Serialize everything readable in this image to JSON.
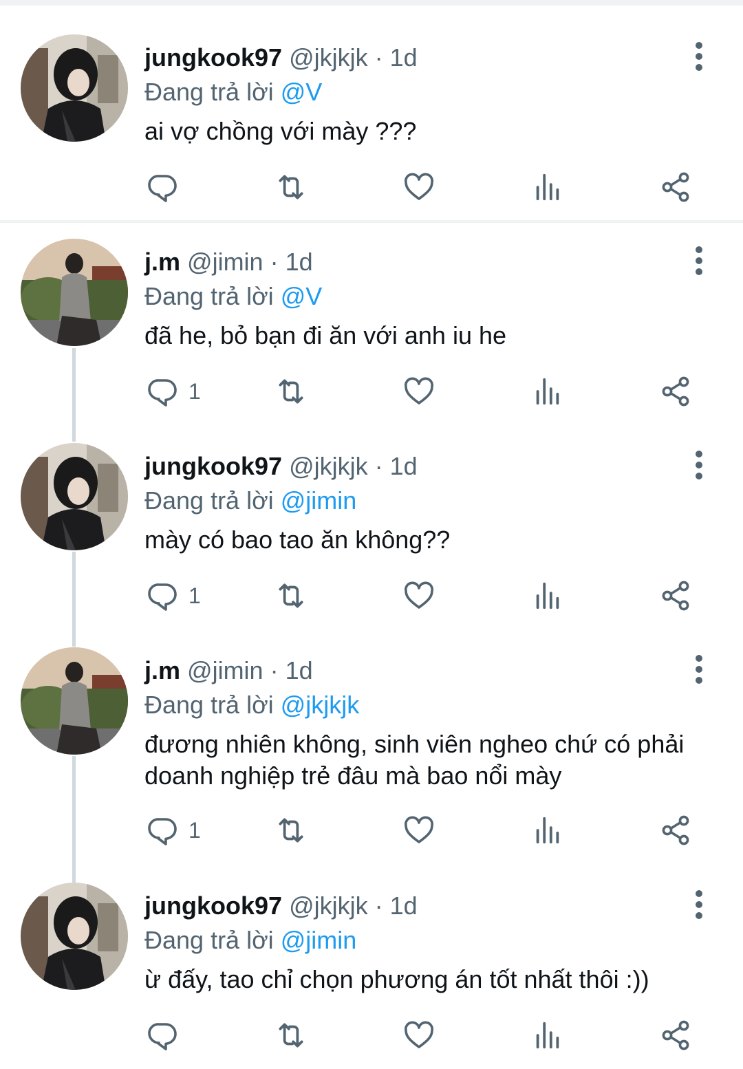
{
  "colors": {
    "accent": "#1d9bf0",
    "text_primary": "#0f1419",
    "text_secondary": "#536471",
    "divider": "#eff3f4",
    "thread_line": "#cfd9de"
  },
  "icons": {
    "reply": "reply-icon",
    "retweet": "retweet-icon",
    "like": "heart-icon",
    "views": "views-icon",
    "share": "share-icon",
    "more": "more-vertical-icon"
  },
  "replying_prefix": "Đang trả lời",
  "tweets": [
    {
      "name": "jungkook97",
      "handle": "@jkjkjk",
      "time": "· 1d",
      "replying_to": "@V",
      "text": "ai vợ chồng với mày ???",
      "reply_count": ""
    },
    {
      "name": "j.m",
      "handle": "@jimin",
      "time": "· 1d",
      "replying_to": "@V",
      "text": "đã he, bỏ bạn đi ăn với anh iu he",
      "reply_count": "1"
    },
    {
      "name": "jungkook97",
      "handle": "@jkjkjk",
      "time": "· 1d",
      "replying_to": "@jimin",
      "text": "mày có bao tao ăn không??",
      "reply_count": "1"
    },
    {
      "name": "j.m",
      "handle": "@jimin",
      "time": "· 1d",
      "replying_to": "@jkjkjk",
      "text_lines": [
        "đương nhiên không, sinh viên ngheo chứ có phải",
        "doanh nghiệp trẻ đâu mà bao nổi mày"
      ],
      "reply_count": "1"
    },
    {
      "name": "jungkook97",
      "handle": "@jkjkjk",
      "time": "· 1d",
      "replying_to": "@jimin",
      "text": "ừ đấy, tao chỉ chọn phương án tốt nhất thôi :))",
      "reply_count": ""
    }
  ]
}
